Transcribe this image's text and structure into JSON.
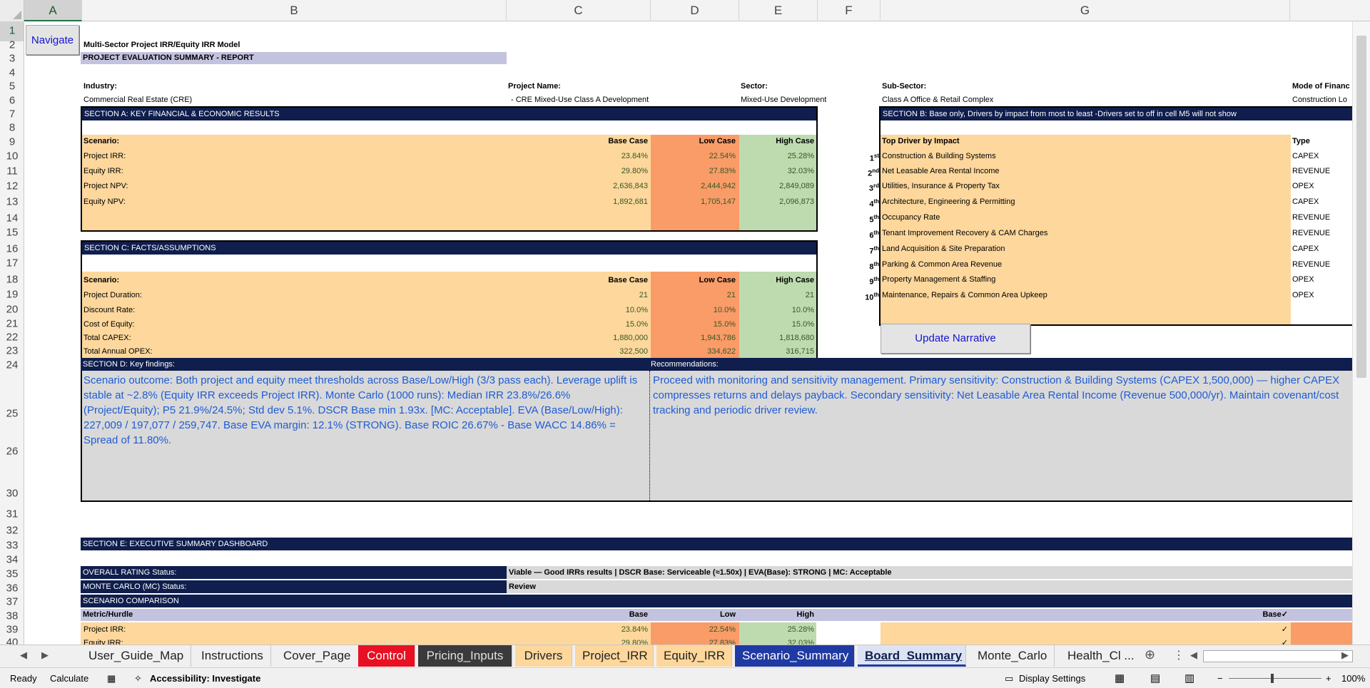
{
  "columns": [
    "A",
    "B",
    "C",
    "D",
    "E",
    "F",
    "G"
  ],
  "rows": [
    "1",
    "2",
    "3",
    "4",
    "5",
    "6",
    "7",
    "8",
    "9",
    "10",
    "11",
    "12",
    "13",
    "14",
    "15",
    "16",
    "17",
    "18",
    "19",
    "20",
    "21",
    "22",
    "23",
    "24",
    "25",
    "26",
    "30",
    "31",
    "32",
    "33",
    "34",
    "35",
    "36",
    "37",
    "38",
    "39",
    "40"
  ],
  "navigate_button": "Navigate",
  "model_title": "Multi-Sector Project IRR/Equity IRR Model",
  "report_title": "PROJECT EVALUATION SUMMARY - REPORT",
  "info": {
    "industry_label": "Industry:",
    "industry_value": "Commercial Real Estate (CRE)",
    "project_label": "Project Name:",
    "project_value": "- CRE Mixed-Use Class A Development",
    "sector_label": "Sector:",
    "sector_value": "Mixed-Use Development",
    "subsector_label": "Sub-Sector:",
    "subsector_value": "Class A Office & Retail Complex",
    "finance_label": "Mode of Financ",
    "finance_value": "Construction Lo"
  },
  "section_a": {
    "title": "SECTION A: KEY FINANCIAL & ECONOMIC RESULTS",
    "scenario_label": "Scenario:",
    "headers": [
      "Base Case",
      "Low Case",
      "High Case"
    ],
    "rows": [
      {
        "label": "Project IRR:",
        "base": "23.84%",
        "low": "22.54%",
        "high": "25.28%"
      },
      {
        "label": "Equity IRR:",
        "base": "29.80%",
        "low": "27.83%",
        "high": "32.03%"
      },
      {
        "label": "Project NPV:",
        "base": "2,636,843",
        "low": "2,444,942",
        "high": "2,849,089"
      },
      {
        "label": "Equity NPV:",
        "base": "1,892,681",
        "low": "1,705,147",
        "high": "2,096,873"
      }
    ]
  },
  "section_b": {
    "title": "SECTION B: Base only,  Drivers by impact from most to least -Drivers set to off in cell M5 will not show",
    "driver_header": "Top Driver by Impact",
    "type_header": "Type",
    "drivers": [
      {
        "rank": "1",
        "suffix": "st",
        "name": "Construction & Building Systems",
        "type": "CAPEX"
      },
      {
        "rank": "2",
        "suffix": "nd",
        "name": "Net Leasable Area Rental Income",
        "type": "REVENUE"
      },
      {
        "rank": "3",
        "suffix": "rd",
        "name": "Utilities, Insurance & Property Tax",
        "type": "OPEX"
      },
      {
        "rank": "4",
        "suffix": "th",
        "name": "Architecture, Engineering & Permitting",
        "type": "CAPEX"
      },
      {
        "rank": "5",
        "suffix": "th",
        "name": "Occupancy Rate",
        "type": "REVENUE"
      },
      {
        "rank": "6",
        "suffix": "th",
        "name": "Tenant Improvement Recovery & CAM Charges",
        "type": "REVENUE"
      },
      {
        "rank": "7",
        "suffix": "th",
        "name": "Land Acquisition & Site Preparation",
        "type": "CAPEX"
      },
      {
        "rank": "8",
        "suffix": "th",
        "name": "Parking & Common Area Revenue",
        "type": "REVENUE"
      },
      {
        "rank": "9",
        "suffix": "th",
        "name": "Property Management & Staffing",
        "type": "OPEX"
      },
      {
        "rank": "10",
        "suffix": "th",
        "name": "Maintenance, Repairs & Common Area Upkeep",
        "type": "OPEX"
      }
    ]
  },
  "update_button": "Update Narrative",
  "section_c": {
    "title": "SECTION C: FACTS/ASSUMPTIONS",
    "scenario_label": "Scenario:",
    "headers": [
      "Base Case",
      "Low Case",
      "High Case"
    ],
    "rows": [
      {
        "label": "Project Duration:",
        "base": "21",
        "low": "21",
        "high": "21"
      },
      {
        "label": "Discount Rate:",
        "base": "10.0%",
        "low": "10.0%",
        "high": "10.0%"
      },
      {
        "label": "Cost of Equity:",
        "base": "15.0%",
        "low": "15.0%",
        "high": "15.0%"
      },
      {
        "label": "Total CAPEX:",
        "base": "1,880,000",
        "low": "1,943,786",
        "high": "1,818,680"
      },
      {
        "label": "Total Annual OPEX:",
        "base": "322,500",
        "low": "334,622",
        "high": "316,715"
      }
    ]
  },
  "section_d": {
    "title": "SECTION D: Key findings:",
    "rec_title": "Recommendations:",
    "findings": "Scenario outcome: Both project and equity meet thresholds across Base/Low/High (3/3 pass each). Leverage uplift is stable at ~2.8% (Equity IRR exceeds Project IRR). Monte Carlo (1000 runs): Median IRR 23.8%/26.6% (Project/Equity); P5 21.9%/24.5%; Std dev 5.1%. DSCR Base min 1.93x. [MC: Acceptable]. EVA (Base/Low/High): 227,009 / 197,077 / 259,747. Base EVA margin: 12.1% (STRONG). Base ROIC 26.67% - Base WACC 14.86% = Spread of 11.80%.",
    "recommendations": "Proceed with monitoring and sensitivity management. Primary sensitivity: Construction & Building Systems (CAPEX 1,500,000) — higher CAPEX compresses returns and delays payback. Secondary sensitivity: Net Leasable Area Rental Income (Revenue 500,000/yr). Maintain covenant/cost tracking and periodic driver review."
  },
  "section_e": {
    "title": "SECTION E: EXECUTIVE SUMMARY DASHBOARD",
    "overall_label": "OVERALL RATING Status:",
    "overall_value": "Viable — Good IRRs results | DSCR Base: Serviceable (≈1.50x) | EVA(Base): STRONG | MC: Acceptable",
    "mc_label": "MONTE CARLO (MC) Status:",
    "mc_value": "Review",
    "comparison_title": "SCENARIO COMPARISON",
    "headers": [
      "Metric/Hurdle",
      "Base",
      "Low",
      "High"
    ],
    "base_check": "Base✓",
    "check": "✓",
    "rows": [
      {
        "label": "Project IRR:",
        "base": "23.84%",
        "low": "22.54%",
        "high": "25.28%"
      },
      {
        "label": "Equity IRR:",
        "base": "29.80%",
        "low": "27.83%",
        "high": "32.03%"
      }
    ]
  },
  "tabs": [
    {
      "label": "User_Guide_Map"
    },
    {
      "label": "Instructions"
    },
    {
      "label": "Cover_Page"
    },
    {
      "label": "Control"
    },
    {
      "label": "Pricing_Inputs"
    },
    {
      "label": "Drivers"
    },
    {
      "label": "Project_IRR"
    },
    {
      "label": "Equity_IRR"
    },
    {
      "label": "Scenario_Summary"
    },
    {
      "label": "Board_Summary"
    },
    {
      "label": "Monte_Carlo"
    },
    {
      "label": "Health_Cl ..."
    }
  ],
  "status_bar": {
    "ready": "Ready",
    "calculate": "Calculate",
    "accessibility": "Accessibility: Investigate",
    "display_settings": "Display Settings",
    "zoom": "100%"
  },
  "colors": {
    "navy": "#0f1e4d",
    "peach": "#fdd79c",
    "orange": "#f99c68",
    "green": "#bddbaf",
    "lavender": "#c3c3e0",
    "note_blue": "#1f5cd6",
    "tab_control": "#e81123",
    "tab_pricing": "#3a3a3a",
    "tab_scenario": "#1f3aa3"
  }
}
